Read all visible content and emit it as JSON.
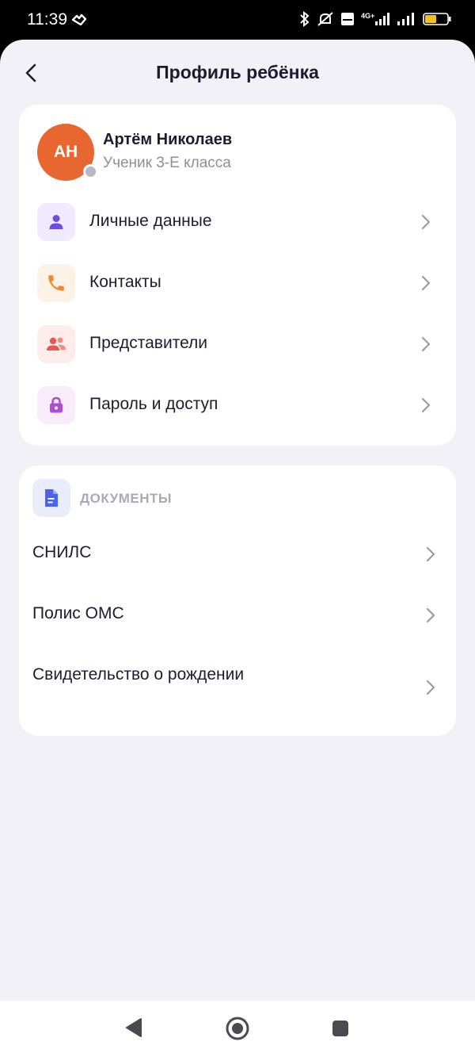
{
  "status": {
    "time": "11:39",
    "battery": "49"
  },
  "header": {
    "title": "Профиль ребёнка"
  },
  "profile": {
    "initials": "АН",
    "name": "Артём Николаев",
    "class_label": "Ученик 3-Е класса",
    "menu": [
      {
        "label": "Личные данные",
        "icon": "person-icon",
        "color": "#6F4CE0",
        "bg": "#EFEAFD"
      },
      {
        "label": "Контакты",
        "icon": "phone-icon",
        "color": "#F08A2E",
        "bg": "#FEF1E6"
      },
      {
        "label": "Представители",
        "icon": "people-icon",
        "color": "#E65A4F",
        "bg": "#FDECEA"
      },
      {
        "label": "Пароль и доступ",
        "icon": "lock-icon",
        "color": "#B04CD0",
        "bg": "#F8ECFB"
      }
    ]
  },
  "documents": {
    "heading": "ДОКУМЕНТЫ",
    "items": [
      {
        "label": "СНИЛС"
      },
      {
        "label": "Полис ОМС"
      },
      {
        "label": "Свидетельство о рождении"
      }
    ]
  },
  "colors": {
    "accent": "#E8662F",
    "background": "#F1F1F7",
    "text": "#1C1C2E",
    "muted": "#8E8E9C"
  }
}
